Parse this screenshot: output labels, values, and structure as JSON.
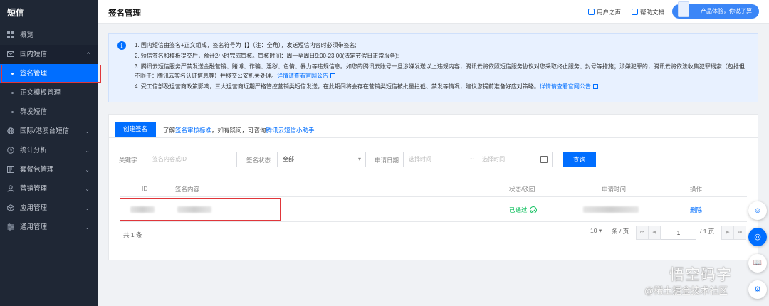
{
  "sidebar": {
    "brand": "短信",
    "items": [
      {
        "label": "概览",
        "icon": "grid-icon",
        "type": "top"
      },
      {
        "label": "国内短信",
        "icon": "mail-icon",
        "type": "group-open",
        "chevron": "^"
      },
      {
        "label": "签名管理",
        "type": "sub-active"
      },
      {
        "label": "正文模板管理",
        "type": "sub"
      },
      {
        "label": "群发短信",
        "type": "sub"
      },
      {
        "label": "国际/港澳台短信",
        "icon": "globe-icon",
        "type": "group",
        "chevron": "⌄"
      },
      {
        "label": "统计分析",
        "icon": "clock-icon",
        "type": "group",
        "chevron": "⌄"
      },
      {
        "label": "套餐包管理",
        "icon": "package-icon",
        "type": "group",
        "chevron": "⌄"
      },
      {
        "label": "营销管理",
        "icon": "user-icon",
        "type": "group",
        "chevron": "⌄"
      },
      {
        "label": "应用管理",
        "icon": "cube-icon",
        "type": "group",
        "chevron": "⌄"
      },
      {
        "label": "通用管理",
        "icon": "settings-icon",
        "type": "group",
        "chevron": "⌄"
      }
    ]
  },
  "topbar": {
    "title": "签名管理",
    "user_voice": "用户之声",
    "help_docs": "帮助文档",
    "promo": "产品体验，你说了算"
  },
  "notice": {
    "info_glyph": "i",
    "items": [
      {
        "text": "1. 国内短信由签名+正文组成，签名符号为【】（注：全角），发送短信内容时必须带签名;"
      },
      {
        "text": "2. 短信签名和模板提交后，预计2小时完成审核。审核时间：周一至周日9:00-23:00(法定节假日正常服务);"
      },
      {
        "text": "3. 腾讯云短信服务严禁发送金融营销、赌博、诈骗、淫秽、色情、暴力等违规信息。如您的腾讯云账号一旦涉嫌发送以上违规内容，腾讯云将依照短信服务协议对您采取终止服务、封号等措施；涉嫌犯罪的，腾讯云将依法收集犯罪线索（包括但不限于：腾讯云实名认证信息等）并移交公安机关处理。",
        "link": "详情请查看官网公告"
      },
      {
        "text": "4. 受工信部及运营商政策影响，三大运营商近期严格管控营销类短信发送，在此期间将会存在营销类短信被批量拦截、禁发等情况，建议您提前准备好应对策略。",
        "link": "详情请查看官网公告"
      }
    ]
  },
  "toolbar": {
    "create_button": "创建签名",
    "hint_prefix": "了解",
    "hint_link1": "签名审核标准",
    "hint_mid": "，如有疑问，可咨询",
    "hint_link2": "腾讯云短信小助手"
  },
  "filters": {
    "keyword_label": "关键字",
    "keyword_placeholder": "签名内容或ID",
    "status_label": "签名状态",
    "status_value": "全部",
    "date_label": "申请日期",
    "date_start_placeholder": "选择时间",
    "date_sep": "~",
    "date_end_placeholder": "选择时间",
    "query_button": "查询"
  },
  "table": {
    "columns": [
      "ID",
      "签名内容",
      "状态/驳回",
      "申请时间",
      "操作"
    ],
    "rows": [
      {
        "status": "已通过",
        "action": "删除"
      }
    ]
  },
  "pagination": {
    "total": "共 1 条",
    "page_size": "10",
    "page_size_suffix": "条 / 页",
    "first": "⏮",
    "prev": "◀",
    "current_page": "1",
    "page_total": "/ 1 页",
    "next": "▶",
    "last": "⏭"
  },
  "float_buttons": [
    "☺",
    "◎",
    "📖",
    "⚙"
  ],
  "watermark": {
    "line1": "悟空码字",
    "line2": "@稀土掘金技术社区"
  },
  "colors": {
    "sidebar_bg": "#1f2735",
    "primary": "#006eff",
    "success": "#0abf5b",
    "highlight_border": "#e0363a",
    "notice_bg": "#e8f1ff"
  }
}
